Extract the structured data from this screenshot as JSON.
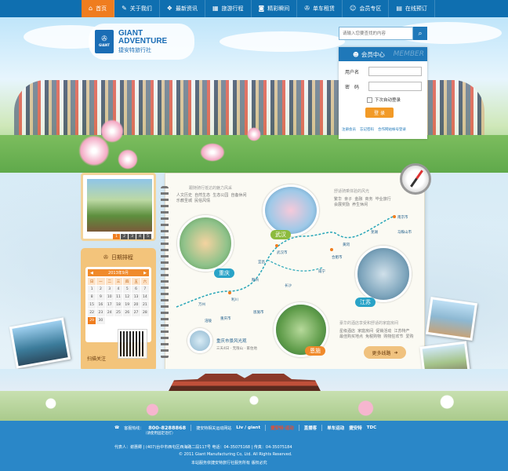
{
  "nav": {
    "items": [
      {
        "label": "首页",
        "icon": "home-icon",
        "glyph": "⌂",
        "active": true
      },
      {
        "label": "关于我们",
        "icon": "edit-icon",
        "glyph": "✎"
      },
      {
        "label": "最新资讯",
        "icon": "news-icon",
        "glyph": "❖"
      },
      {
        "label": "旅游行程",
        "icon": "calendar-icon",
        "glyph": "▦"
      },
      {
        "label": "精彩瞬间",
        "icon": "camera-icon",
        "glyph": "◙"
      },
      {
        "label": "单车租赁",
        "icon": "bike-icon",
        "glyph": "✇"
      },
      {
        "label": "会员专区",
        "icon": "members-icon",
        "glyph": "☺"
      },
      {
        "label": "在线预订",
        "icon": "booking-icon",
        "glyph": "▤"
      }
    ]
  },
  "logo": {
    "line1": "GIANT",
    "line2": "ADVENTURE",
    "cn": "捷安特旅行社",
    "mark": "GIANT"
  },
  "search": {
    "placeholder": "请输入您要查找的内容",
    "icon": "search-icon"
  },
  "member": {
    "title": "会员中心",
    "watermark": "MEMBER",
    "username_label": "用户名",
    "password_label": "密　码",
    "auto_login": "下次自动登录",
    "login_button": "登 录",
    "links": [
      "注册会员",
      "忘记密码",
      "合作网站帐号登录"
    ]
  },
  "slider": {
    "pages": [
      "1",
      "2",
      "3",
      "4",
      "5"
    ],
    "active": 1
  },
  "schedule": {
    "title": "日期排程",
    "month": "2013年9月",
    "weekdays": [
      "日",
      "一",
      "二",
      "三",
      "四",
      "五",
      "六"
    ],
    "days": [
      "1",
      "2",
      "3",
      "4",
      "5",
      "6",
      "7",
      "8",
      "9",
      "10",
      "11",
      "12",
      "13",
      "14",
      "15",
      "16",
      "17",
      "18",
      "19",
      "20",
      "21",
      "22",
      "23",
      "24",
      "25",
      "26",
      "27",
      "28",
      "29",
      "30"
    ],
    "selected": "29",
    "qr_caption": "扫描关注"
  },
  "book": {
    "wuhan_title": "跟随骑行抵达的魅力风采",
    "wuhan_tags": "人文历史  自然生态  生态公园  自备休闲\n乐教圣城  民俗风情",
    "suzhou_title": "舒适骑乘体验的风光",
    "suzhou_tags": "繁华  亲子  金融  商务  毕业旅行\n会展奖励  养生休闲",
    "bottom_title": "豪华的酒店享受和舒适的家庭房间",
    "bottom_tags": "星级酒店  家庭房间  促销活动  江苏特产\n最佳购买地点  免税购物  购物狂欢节  爱购",
    "chongqing_card_title": "重庆市景风光观",
    "chongqing_card_sub": "三天4日 · 无限山 · 家住地",
    "labels": {
      "wuhan": "武汉",
      "chongqing": "重庆",
      "jiangsu": "江苏",
      "enshi": "恩施"
    },
    "cities": [
      "重庆市",
      "武汉市",
      "合肥市",
      "南京市",
      "马鞍山市",
      "宜昌",
      "荆州",
      "咸宁",
      "恩施市",
      "利川",
      "万州",
      "涪陵",
      "黄冈",
      "芜湖",
      "长沙"
    ],
    "more": "更多线路"
  },
  "footer": {
    "hotline_label": "客服热线：",
    "hotline": "800-8288868",
    "hotline_note": "（请使用固定话打）",
    "follow": "捷安特相关运动网站",
    "partners": [
      "Liv / giant",
      "捷安特·运动",
      "直播客",
      "单车运动",
      "捷安特",
      "TDC"
    ],
    "address": "代表人：谢惠卿  |  (407)台中市西屯区西海路二段117号  电话：04-35075168  |  传真：04-35075184",
    "copyright": "© 2011 Giant Manufacturing Co, Ltd. All Rights Reserved.",
    "icp": "本站服务依捷安特旅行社服务所有 版权必究"
  },
  "colors": {
    "nav": "#0f6fb0",
    "active": "#ef7d1f",
    "footer": "#2a87c8",
    "accent": "#f29a27"
  }
}
